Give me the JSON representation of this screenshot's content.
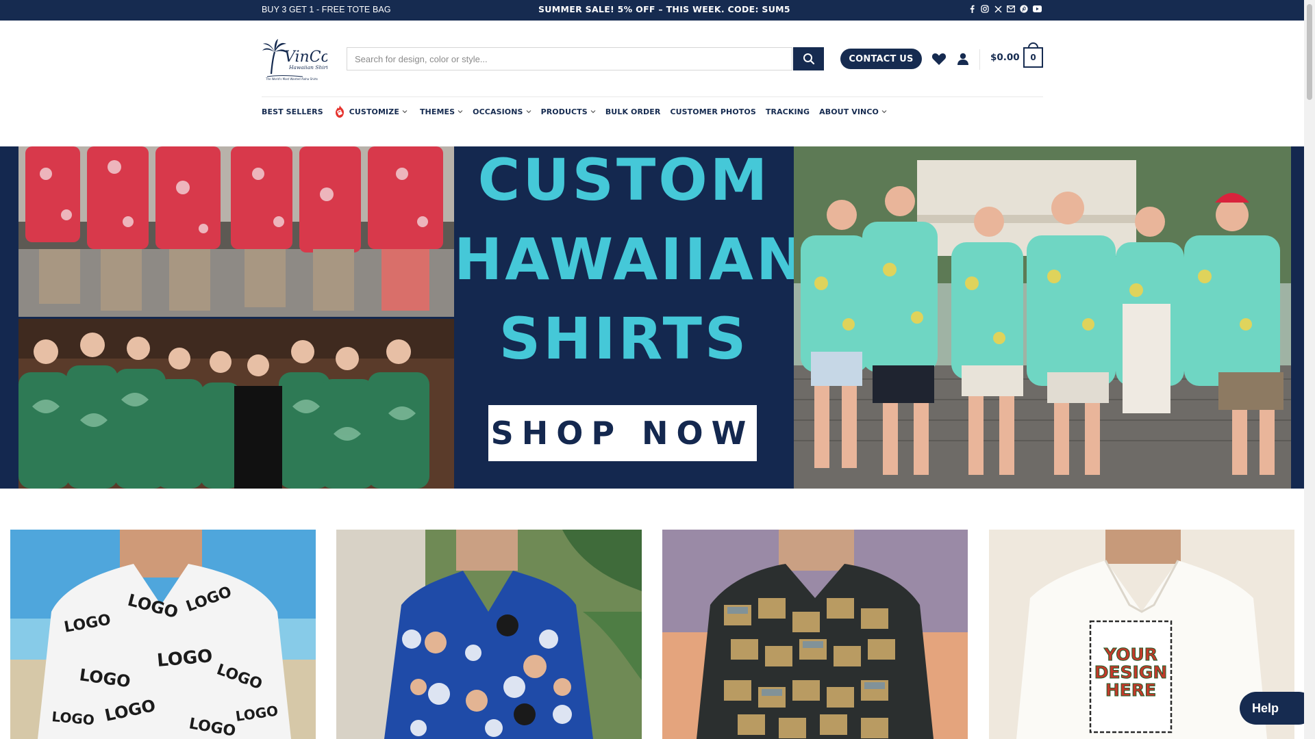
{
  "topbar": {
    "promo_left": "BUY 3 GET 1 - FREE TOTE BAG",
    "promo_center": "SUMMER SALE! 5% OFF – THIS WEEK. CODE: SUM5",
    "socials": [
      "facebook-icon",
      "instagram-icon",
      "x-icon",
      "email-icon",
      "pinterest-icon",
      "youtube-icon"
    ],
    "background": "#162b50"
  },
  "header": {
    "logo_text": "VinCo",
    "logo_subtext": "Hawaiian Shirts",
    "logo_tagline": "The World's Most Wanted Aloha Shirts",
    "search_placeholder": "Search for design, color or style...",
    "contact_label": "CONTACT US",
    "cart_total": "$0.00",
    "cart_count": "0"
  },
  "nav": {
    "items": [
      {
        "label": "BEST SELLERS",
        "dropdown": false
      },
      {
        "label": "CUSTOMIZE",
        "dropdown": true
      },
      {
        "label": "THEMES",
        "dropdown": true
      },
      {
        "label": "OCCASIONS",
        "dropdown": true
      },
      {
        "label": "PRODUCTS",
        "dropdown": true
      },
      {
        "label": "BULK ORDER",
        "dropdown": false
      },
      {
        "label": "CUSTOMER PHOTOS",
        "dropdown": false
      },
      {
        "label": "TRACKING",
        "dropdown": false
      },
      {
        "label": "ABOUT VINCO",
        "dropdown": true
      }
    ]
  },
  "hero": {
    "line1": "CUSTOM",
    "line2": "HAWAIIAN",
    "line3": "SHIRTS",
    "cta": "SHOP NOW",
    "title_color": "#45c8d8",
    "bg_color": "#14284f"
  },
  "products": {
    "card4_text": "YOUR DESIGN HERE",
    "card1_logo_word": "LOGO"
  },
  "help": {
    "label": "Help"
  },
  "colors": {
    "brand_navy": "#162b50"
  }
}
